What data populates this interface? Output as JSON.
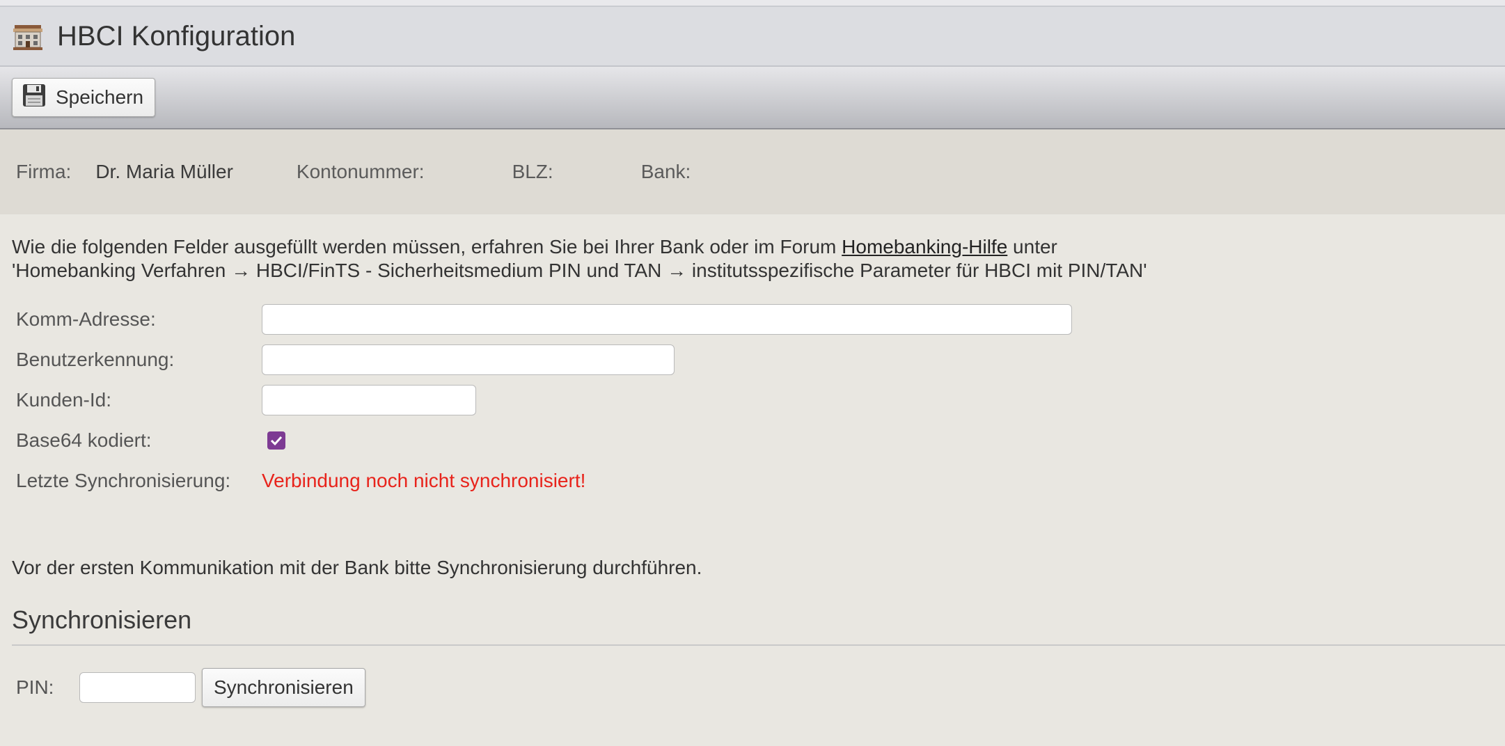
{
  "header": {
    "title": "HBCI Konfiguration",
    "icon": "bank-building-icon"
  },
  "toolbar": {
    "save_label": "Speichern",
    "save_icon": "floppy-disk-icon"
  },
  "info": {
    "firma_label": "Firma:",
    "firma_value": "Dr. Maria Müller",
    "konto_label": "Kontonummer:",
    "blz_label": "BLZ:",
    "bank_label": "Bank:"
  },
  "intro": {
    "text_before_link": "Wie die folgenden Felder ausgefüllt werden müssen, erfahren Sie bei Ihrer Bank oder im Forum ",
    "link": "Homebanking-Hilfe",
    "text_after_link": " unter",
    "line2": "'Homebanking Verfahren → HBCI/FinTS - Sicherheitsmedium PIN und TAN → institutsspezifische Parameter für HBCI mit PIN/TAN'"
  },
  "form": {
    "komm_label": "Komm-Adresse:",
    "komm_value": "",
    "benutzer_label": "Benutzerkennung:",
    "benutzer_value": "",
    "kunden_label": "Kunden-Id:",
    "kunden_value": "",
    "base64_label": "Base64 kodiert:",
    "base64_checked": true,
    "sync_label": "Letzte Synchronisierung:",
    "sync_status": "Verbindung noch nicht synchronisiert!"
  },
  "note": "Vor der ersten Kommunikation mit der Bank bitte Synchronisierung durchführen.",
  "sync": {
    "section_title": "Synchronisieren",
    "pin_label": "PIN:",
    "pin_value": "",
    "button_label": "Synchronisieren"
  },
  "colors": {
    "error": "#e8231b",
    "checkbox": "#7d3b93"
  }
}
